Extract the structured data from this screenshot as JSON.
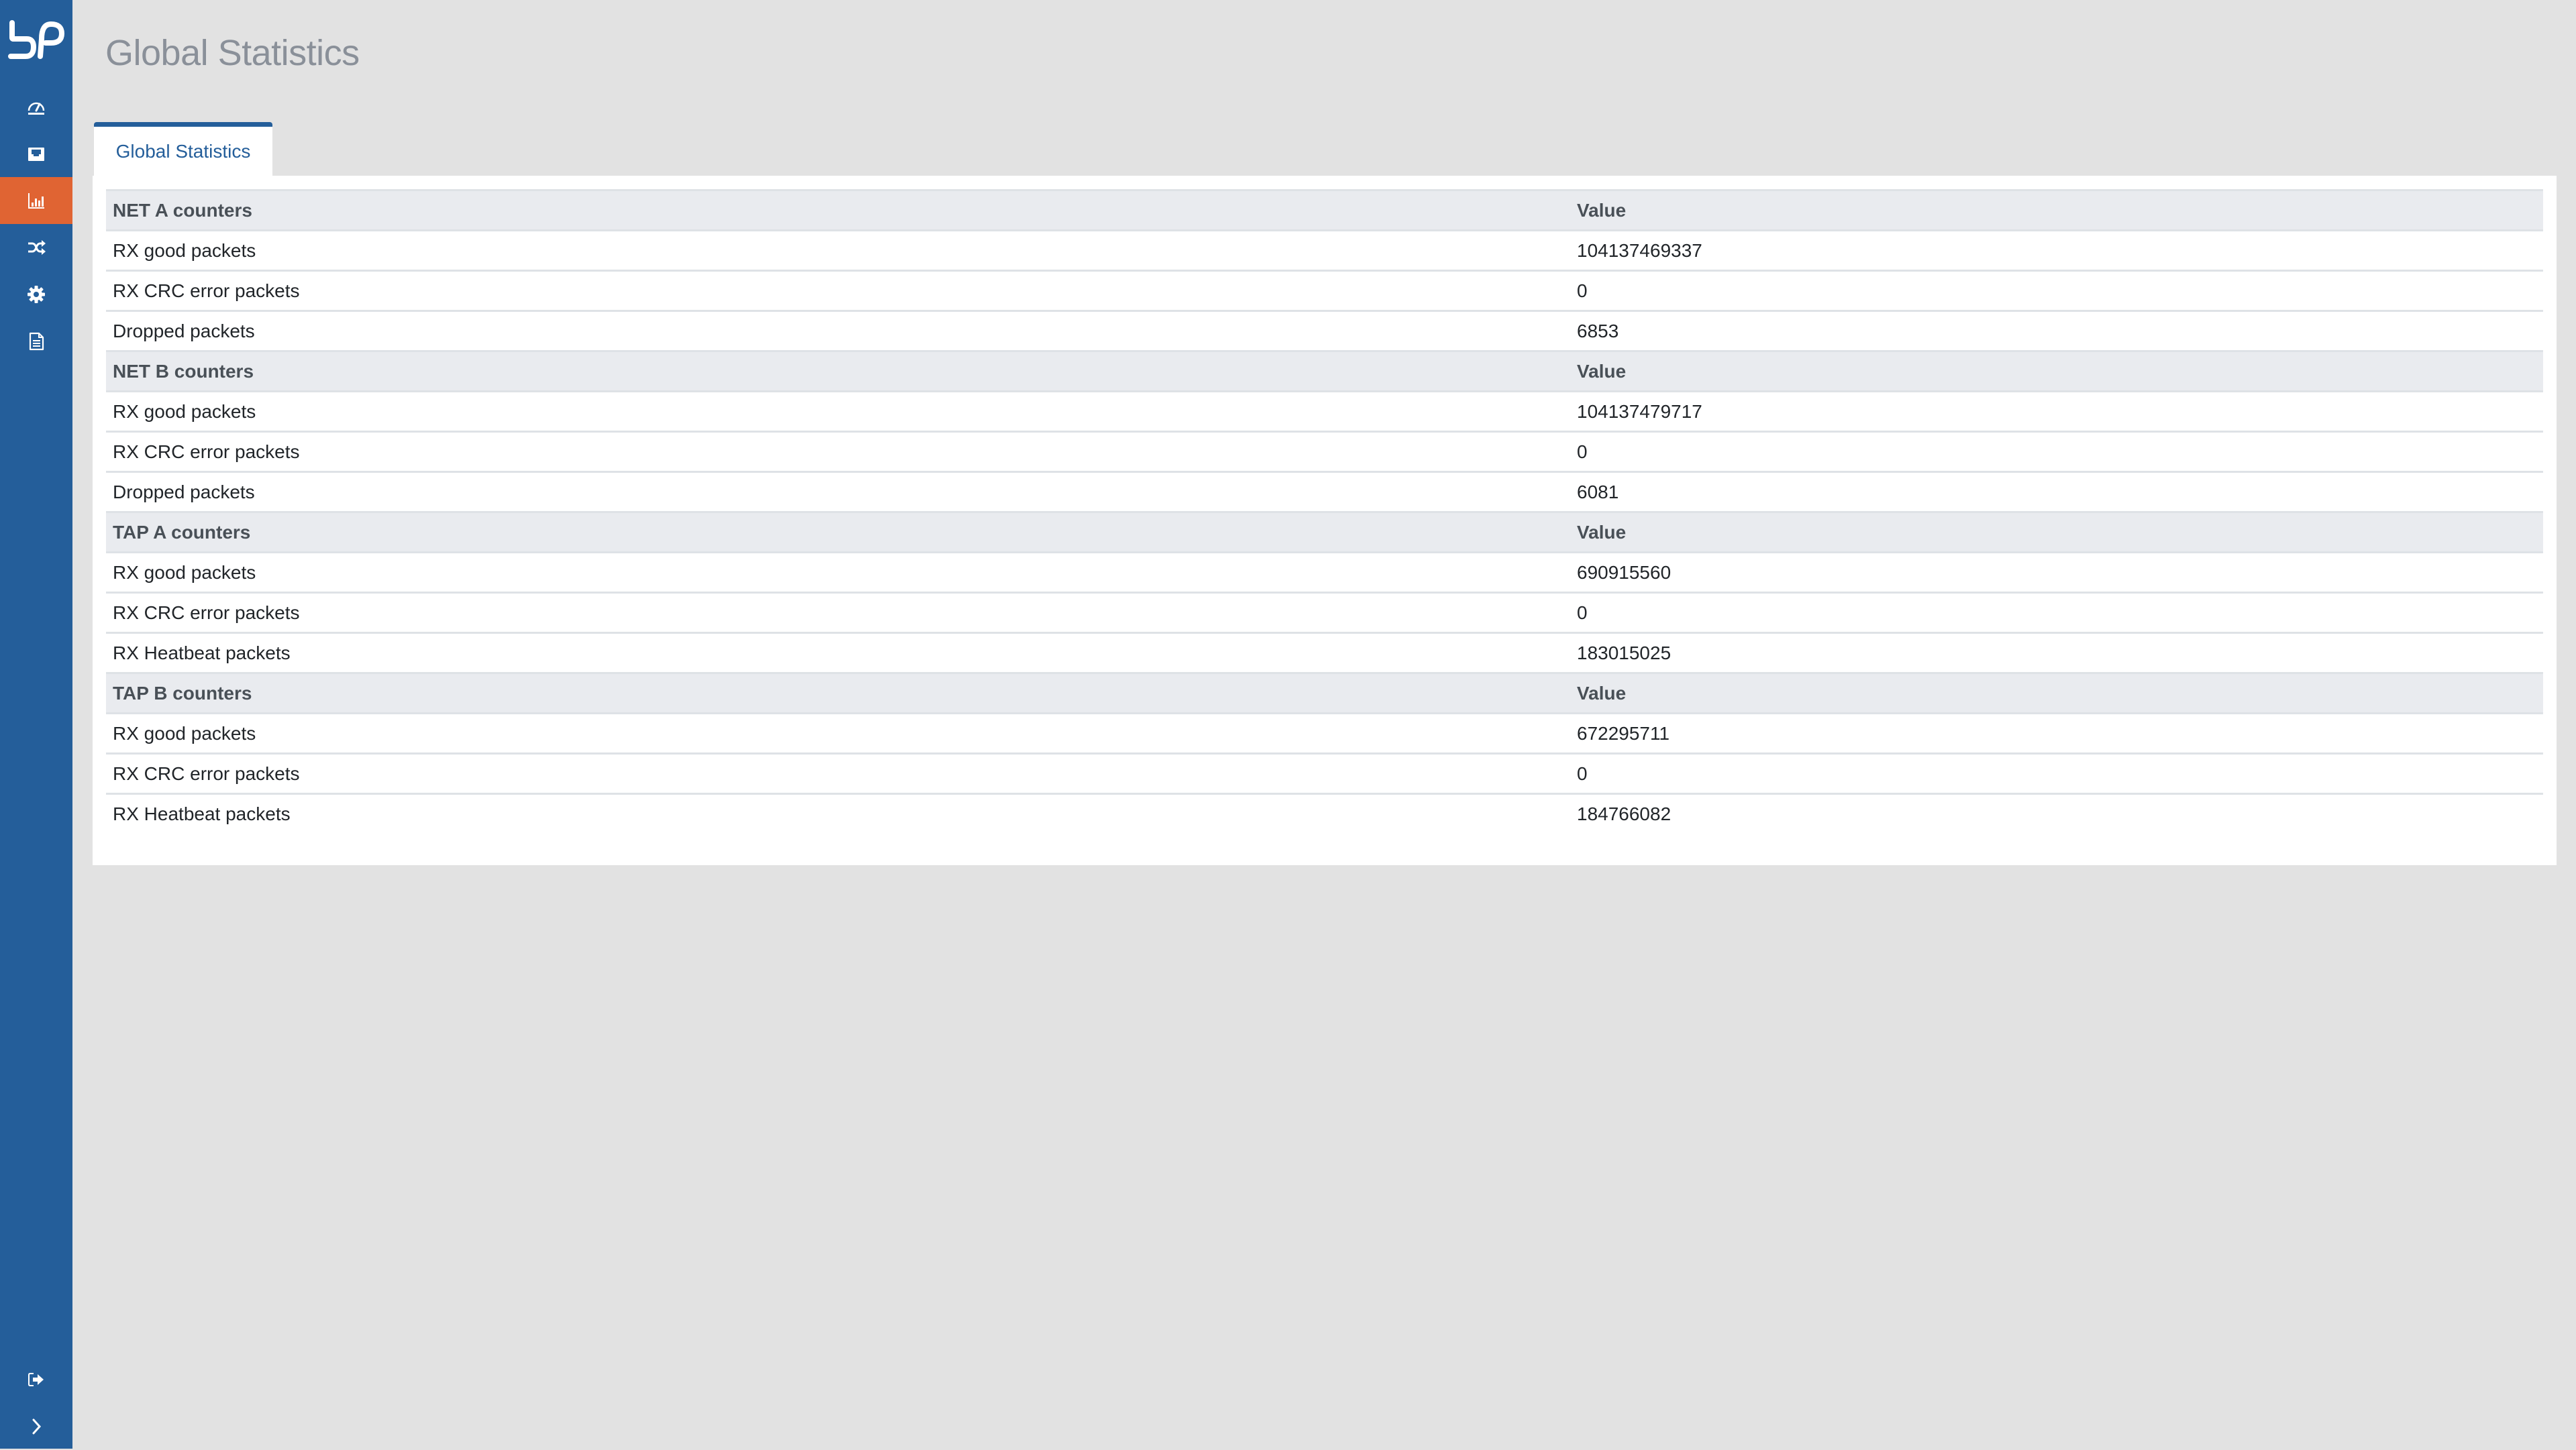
{
  "app": {
    "logo_text": "bP",
    "colors": {
      "sidebar": "#245e9a",
      "active_nav": "#e06433",
      "title": "#8a9099",
      "tab_accent": "#245e9a",
      "header_row_bg": "#e9ebef"
    }
  },
  "sidebar": {
    "items": [
      {
        "icon": "dashboard-gauge-icon",
        "active": false
      },
      {
        "icon": "ethernet-port-icon",
        "active": false
      },
      {
        "icon": "bar-chart-icon",
        "active": true
      },
      {
        "icon": "shuffle-icon",
        "active": false
      },
      {
        "icon": "gear-icon",
        "active": false
      },
      {
        "icon": "document-icon",
        "active": false
      }
    ],
    "bottom": [
      {
        "icon": "logout-icon"
      },
      {
        "icon": "chevron-right-icon"
      }
    ]
  },
  "page": {
    "title": "Global Statistics"
  },
  "tabs": [
    {
      "label": "Global Statistics",
      "active": true
    }
  ],
  "groups": [
    {
      "header": "NET A counters",
      "value_header": "Value",
      "rows": [
        {
          "label": "RX good packets",
          "value": "104137469337"
        },
        {
          "label": "RX CRC error packets",
          "value": "0"
        },
        {
          "label": "Dropped packets",
          "value": "6853"
        }
      ]
    },
    {
      "header": "NET B counters",
      "value_header": "Value",
      "rows": [
        {
          "label": "RX good packets",
          "value": "104137479717"
        },
        {
          "label": "RX CRC error packets",
          "value": "0"
        },
        {
          "label": "Dropped packets",
          "value": "6081"
        }
      ]
    },
    {
      "header": "TAP A counters",
      "value_header": "Value",
      "rows": [
        {
          "label": "RX good packets",
          "value": "690915560"
        },
        {
          "label": "RX CRC error packets",
          "value": "0"
        },
        {
          "label": "RX Heatbeat packets",
          "value": "183015025"
        }
      ]
    },
    {
      "header": "TAP B counters",
      "value_header": "Value",
      "rows": [
        {
          "label": "RX good packets",
          "value": "672295711"
        },
        {
          "label": "RX CRC error packets",
          "value": "0"
        },
        {
          "label": "RX Heatbeat packets",
          "value": "184766082"
        }
      ]
    }
  ]
}
